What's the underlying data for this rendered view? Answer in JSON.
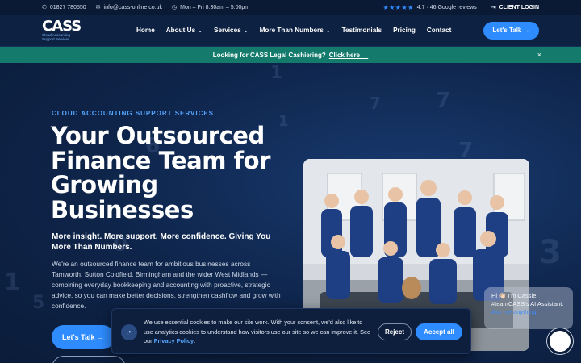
{
  "topbar": {
    "phone": "01827 780550",
    "email": "info@cass-online.co.uk",
    "hours": "Mon – Fri 8:30am – 5:00pm",
    "stars": "★★★★★",
    "rating": "4.7 · 46 Google reviews",
    "login": "CLIENT LOGIN"
  },
  "header": {
    "logo_mark": "CASS",
    "logo_sub_1": "Cloud Accounting",
    "logo_sub_2": "Support Services",
    "nav": [
      {
        "label": "Home",
        "dropdown": false
      },
      {
        "label": "About Us",
        "dropdown": true
      },
      {
        "label": "Services",
        "dropdown": true
      },
      {
        "label": "More Than Numbers",
        "dropdown": true
      },
      {
        "label": "Testimonials",
        "dropdown": false
      },
      {
        "label": "Pricing",
        "dropdown": false
      },
      {
        "label": "Contact",
        "dropdown": false
      }
    ],
    "cta": "Let's Talk →"
  },
  "banner": {
    "text": "Looking for CASS Legal Cashiering?",
    "link": "Click here →",
    "close": "×"
  },
  "hero": {
    "eyebrow": "CLOUD ACCOUNTING SUPPORT SERVICES",
    "title": "Your Outsourced Finance Team for Growing Businesses",
    "subtitle": "More insight. More support. More confidence. Giving You More Than Numbers.",
    "paragraph": "We're an outsourced finance team for ambitious businesses across Tamworth, Sutton Coldfield, Birmingham and the wider West Midlands — combining everyday bookkeeping and accounting with proactive, strategic advice, so you can make better decisions, strengthen cashflow and grow with confidence.",
    "cta": "Let's Talk →"
  },
  "cookie": {
    "text": "We use essential cookies to make our site work. With your consent, we'd also like to use analytics cookies to understand how visitors use our site so we can improve it. See our ",
    "link": "Privacy Policy",
    "after": ".",
    "reject": "Reject",
    "accept": "Accept all"
  },
  "chat": {
    "text": "Hi 👋🏻 I'm Cassie, #teamCASS's AI Assistant.",
    "link": "Ask me anything."
  },
  "colors": {
    "accent": "#2f8cff",
    "banner": "#137a6c",
    "background": "#0c1e3c"
  }
}
